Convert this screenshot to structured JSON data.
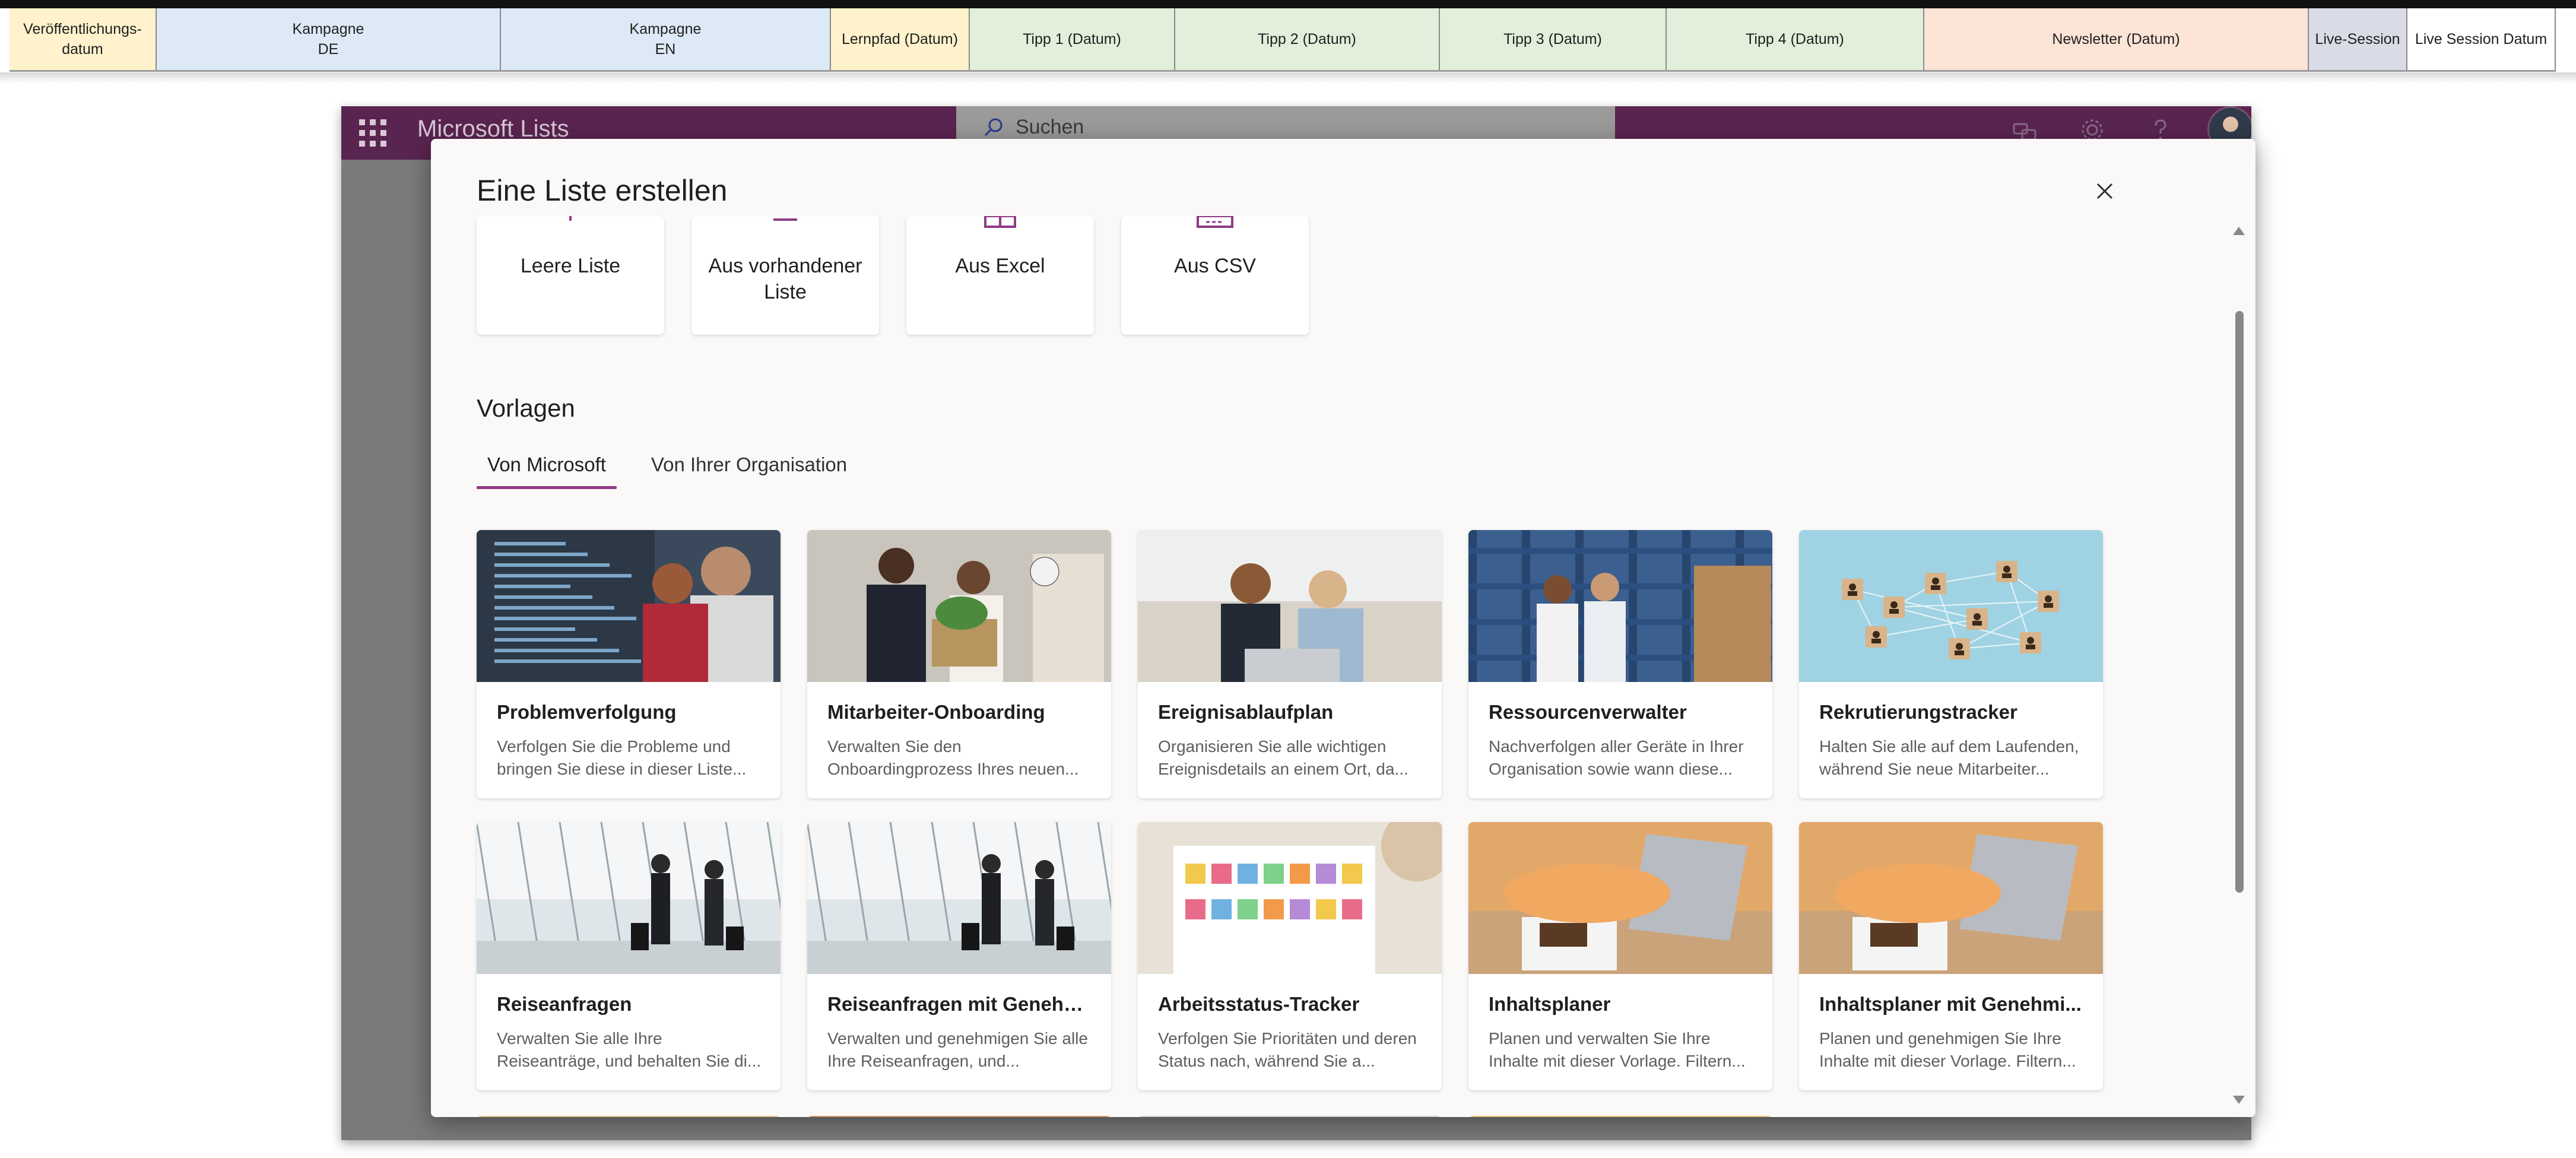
{
  "spreadsheet": {
    "columns": [
      {
        "label": "Veröffentlichungs-\ndatum",
        "color": "#fff2cc"
      },
      {
        "label": "Kampagne\nDE",
        "color": "#dde9f6"
      },
      {
        "label": "Kampagne\nEN",
        "color": "#dde9f6"
      },
      {
        "label": "Lernpfad (Datum)",
        "color": "#fff2cc"
      },
      {
        "label": "Tipp 1 (Datum)",
        "color": "#e2efda"
      },
      {
        "label": "Tipp 2 (Datum)",
        "color": "#e2efda"
      },
      {
        "label": "Tipp 3 (Datum)",
        "color": "#e2efda"
      },
      {
        "label": "Tipp 4 (Datum)",
        "color": "#e2efda"
      },
      {
        "label": "Newsletter (Datum)",
        "color": "#fce4d6"
      },
      {
        "label": "Live-Session",
        "color": "#d9dce6"
      },
      {
        "label": "Live Session Datum",
        "color": "#ffffff"
      }
    ]
  },
  "app": {
    "title": "Microsoft Lists",
    "search_placeholder": "Suchen",
    "icons": [
      "waffle-icon",
      "share-icon",
      "gear-icon",
      "help-icon",
      "avatar"
    ]
  },
  "dialog": {
    "title": "Eine Liste erstellen",
    "close_icon": "close-icon",
    "create_options": [
      {
        "label": "Leere Liste",
        "icon": "blank-list-icon"
      },
      {
        "label": "Aus vorhandener Liste",
        "icon": "existing-list-icon"
      },
      {
        "label": "Aus Excel",
        "icon": "excel-icon"
      },
      {
        "label": "Aus CSV",
        "icon": "csv-icon"
      }
    ],
    "templates_heading": "Vorlagen",
    "tabs": [
      {
        "label": "Von Microsoft",
        "active": true
      },
      {
        "label": "Von Ihrer Organisation",
        "active": false
      }
    ],
    "templates": [
      {
        "name": "Problemverfolgung",
        "desc": "Verfolgen Sie die Probleme und bringen Sie diese in dieser Liste...",
        "image": "developers-at-monitor",
        "color": "#3a4a5c"
      },
      {
        "name": "Mitarbeiter-Onboarding",
        "desc": "Verwalten Sie den Onboardingprozess Ihres neuen...",
        "image": "handshake-office",
        "color": "#c9c4bc"
      },
      {
        "name": "Ereignisablaufplan",
        "desc": "Organisieren Sie alle wichtigen Ereignisdetails an einem Ort, da...",
        "image": "women-laptop",
        "color": "#d8d2c8"
      },
      {
        "name": "Ressourcenverwalter",
        "desc": "Nachverfolgen aller Geräte in Ihrer Organisation sowie wann diese...",
        "image": "warehouse",
        "color": "#3b5f8e"
      },
      {
        "name": "Rekrutierungstracker",
        "desc": "Halten Sie alle auf dem Laufenden, während Sie neue Mitarbeiter...",
        "image": "network-blocks",
        "color": "#9fd3e3"
      },
      {
        "name": "Reiseanfragen",
        "desc": "Verwalten Sie alle Ihre Reiseanträge, und behalten Sie di...",
        "image": "airport-travelers",
        "color": "#dfe6ea"
      },
      {
        "name": "Reiseanfragen mit Genehm...",
        "desc": "Verwalten und genehmigen Sie alle Ihre Reiseanfragen, und...",
        "image": "airport-travelers",
        "color": "#dfe6ea"
      },
      {
        "name": "Arbeitsstatus-Tracker",
        "desc": "Verfolgen Sie Prioritäten und deren Status nach, während Sie a...",
        "image": "sticky-notes-board",
        "color": "#e8e2d6"
      },
      {
        "name": "Inhaltsplaner",
        "desc": "Planen und verwalten Sie Ihre Inhalte mit dieser Vorlage. Filtern...",
        "image": "laptop-writing",
        "color": "#e2a86a"
      },
      {
        "name": "Inhaltsplaner mit Genehmi...",
        "desc": "Planen und genehmigen Sie Ihre Inhalte mit dieser Vorlage. Filtern...",
        "image": "laptop-writing",
        "color": "#e2a86a"
      }
    ],
    "partial_row_colors": [
      "#e9c48a",
      "#d49a6a",
      "#cfcfcf",
      "#e8c070"
    ]
  }
}
